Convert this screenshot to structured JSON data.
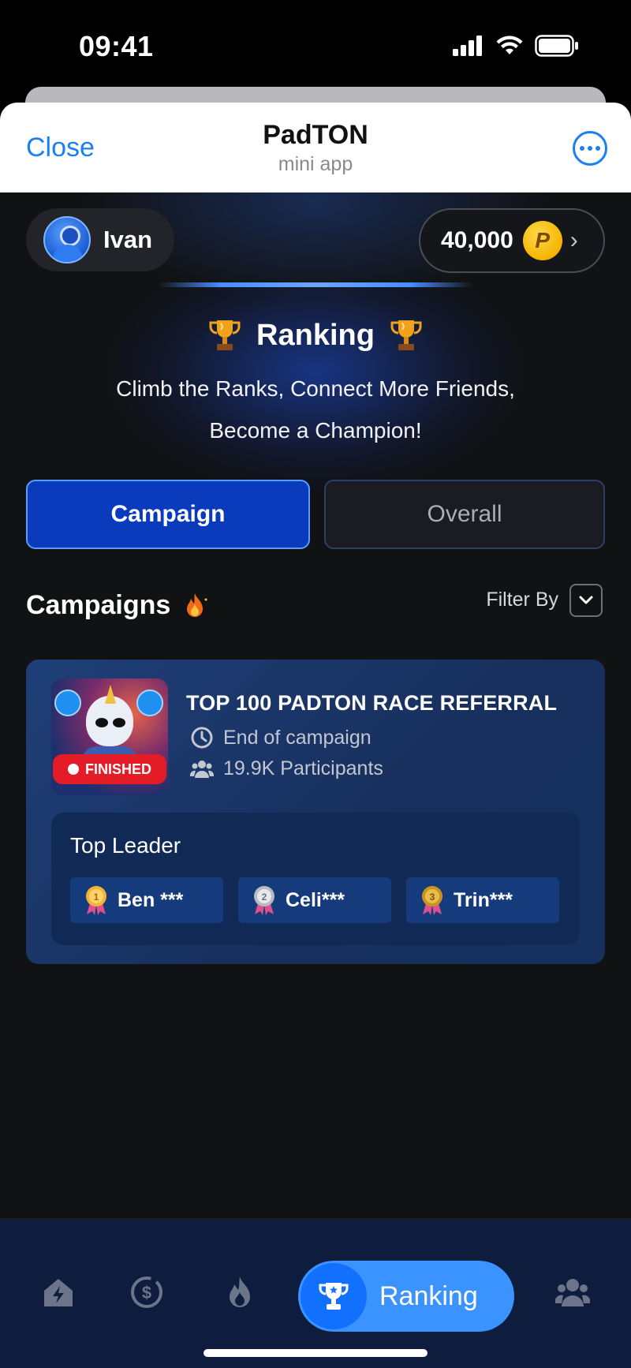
{
  "status_bar": {
    "time": "09:41"
  },
  "telegram": {
    "close_label": "Close",
    "title": "PadTON",
    "subtitle": "mini app"
  },
  "user": {
    "name": "Ivan"
  },
  "balance": {
    "value": "40,000",
    "coin_symbol": "P"
  },
  "hero": {
    "title": "Ranking",
    "subtitle_line1": "Climb the Ranks, Connect More Friends,",
    "subtitle_line2": "Become a Champion!"
  },
  "tabs": [
    {
      "label": "Campaign",
      "active": true
    },
    {
      "label": "Overall",
      "active": false
    }
  ],
  "campaigns": {
    "title": "Campaigns",
    "filter_label": "Filter By"
  },
  "campaign_card": {
    "status": "FINISHED",
    "title": "TOP 100 PADTON RACE REFERRAL",
    "end_text": "End of campaign",
    "participants": "19.9K Participants",
    "leaders_title": "Top Leader",
    "leaders": [
      {
        "rank": "1",
        "name": "Ben ***"
      },
      {
        "rank": "2",
        "name": "Celi***"
      },
      {
        "rank": "3",
        "name": "Trin***"
      }
    ]
  },
  "bottom_nav": {
    "active_label": "Ranking",
    "items": [
      "home-icon",
      "coin-dollar-icon",
      "fire-icon",
      "trophy-icon",
      "friends-icon"
    ]
  },
  "colors": {
    "accent": "#1a7ff5",
    "tab_active": "#0a3bbd",
    "nav_active": "#3a93ff",
    "finished_badge": "#e41c28",
    "coin": "#f5b400"
  }
}
